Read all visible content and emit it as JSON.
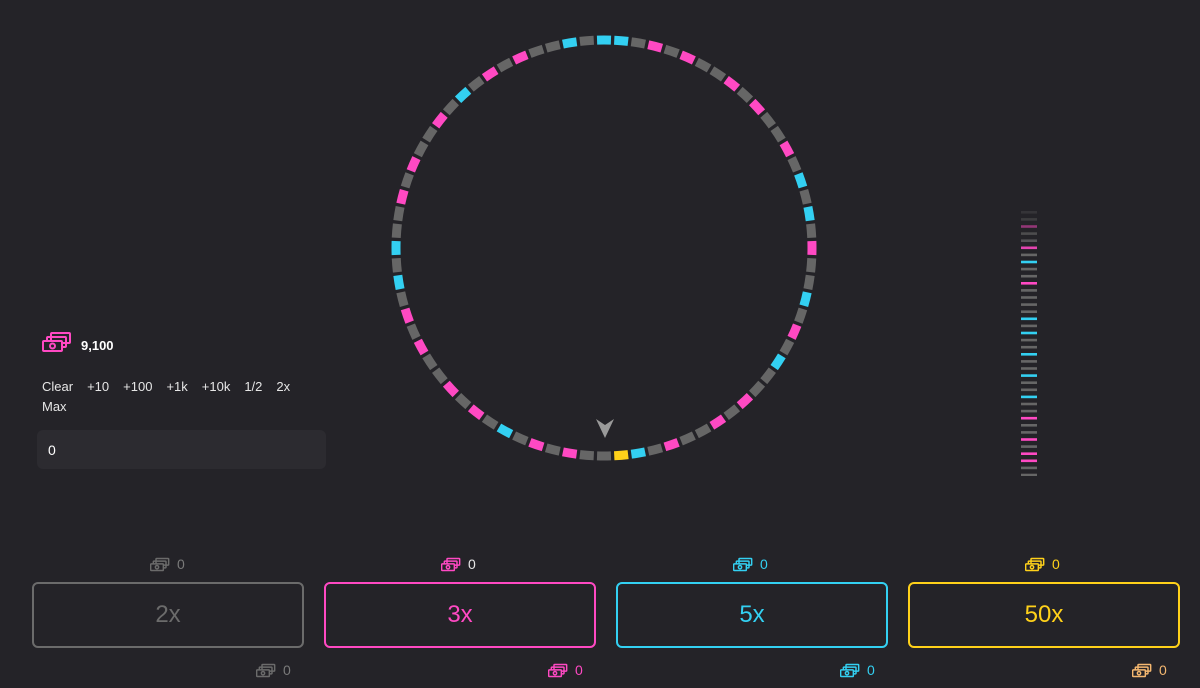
{
  "colors": {
    "background": "#242328",
    "grey": "#666666",
    "pink": "#ff49c3",
    "cyan": "#33d0f2",
    "yellow": "#ffd11a"
  },
  "wheel": {
    "segments": [
      "c",
      "c",
      "g",
      "p",
      "g",
      "p",
      "g",
      "g",
      "p",
      "g",
      "p",
      "g",
      "g",
      "p",
      "g",
      "c",
      "g",
      "c",
      "g",
      "p",
      "g",
      "g",
      "c",
      "g",
      "p",
      "g",
      "c",
      "g",
      "g",
      "p",
      "g",
      "p",
      "g",
      "g",
      "p",
      "g",
      "c",
      "y",
      "g",
      "g",
      "p",
      "g",
      "p",
      "g",
      "c",
      "g",
      "p",
      "g",
      "p",
      "g",
      "g",
      "p",
      "g",
      "p",
      "g",
      "c",
      "g",
      "c",
      "g",
      "g",
      "p",
      "g",
      "p",
      "g",
      "g",
      "p",
      "g",
      "c",
      "g",
      "p",
      "g",
      "p",
      "g",
      "g",
      "c",
      "g"
    ],
    "pointer_icon": "arrow-down-pointer-icon"
  },
  "history": [
    "g",
    "g",
    "p",
    "g",
    "g",
    "p",
    "g",
    "c",
    "g",
    "g",
    "p",
    "g",
    "g",
    "g",
    "g",
    "c",
    "g",
    "c",
    "g",
    "g",
    "c",
    "g",
    "g",
    "c",
    "g",
    "g",
    "c",
    "g",
    "g",
    "p",
    "g",
    "g",
    "p",
    "g",
    "p",
    "p",
    "g",
    "g"
  ],
  "balance": {
    "icon": "money-stack-icon",
    "value": "9,100"
  },
  "quick_bets": [
    "Clear",
    "+10",
    "+100",
    "+1k",
    "+10k",
    "1/2",
    "2x",
    "Max"
  ],
  "amount_input": {
    "value": "0"
  },
  "bets": [
    {
      "label": "2x",
      "color": "#6b6b6b",
      "top_total": "0",
      "bottom_total": "0"
    },
    {
      "label": "3x",
      "color": "#ff49c3",
      "top_total": "0",
      "bottom_total": "0"
    },
    {
      "label": "5x",
      "color": "#33d0f2",
      "top_total": "0",
      "bottom_total": "0"
    },
    {
      "label": "50x",
      "color": "#ffd11a",
      "top_total": "0",
      "bottom_total": "0"
    }
  ]
}
